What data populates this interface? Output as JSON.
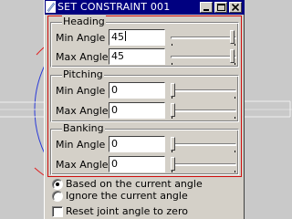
{
  "window": {
    "title": "SET CONSTRAINT 001",
    "buttons": [
      "minimize",
      "maximize",
      "close"
    ]
  },
  "groups": [
    {
      "label": "Heading",
      "rows": [
        {
          "label": "Min Angle",
          "value": "45",
          "slider_fraction": 0.97
        },
        {
          "label": "Max Angle",
          "value": "45",
          "slider_fraction": 0.97
        }
      ]
    },
    {
      "label": "Pitching",
      "rows": [
        {
          "label": "Min Angle",
          "value": "0",
          "slider_fraction": 0.0
        },
        {
          "label": "Max Angle",
          "value": "0",
          "slider_fraction": 0.0
        }
      ]
    },
    {
      "label": "Banking",
      "rows": [
        {
          "label": "Min Angle",
          "value": "0",
          "slider_fraction": 0.0
        },
        {
          "label": "Max Angle",
          "value": "0",
          "slider_fraction": 0.0
        }
      ]
    }
  ],
  "options": {
    "based_on_current": {
      "label": "Based on the current angle",
      "selected": true
    },
    "ignore_current": {
      "label": "Ignore the current angle",
      "selected": false
    },
    "reset_joint": {
      "label": "Reset joint angle to zero",
      "checked": false
    }
  },
  "colors": {
    "titlebar": "#000080",
    "dialog_face": "#d4d0c8",
    "highlight_frame": "#d01010",
    "viewport": "#c9c9c9"
  }
}
